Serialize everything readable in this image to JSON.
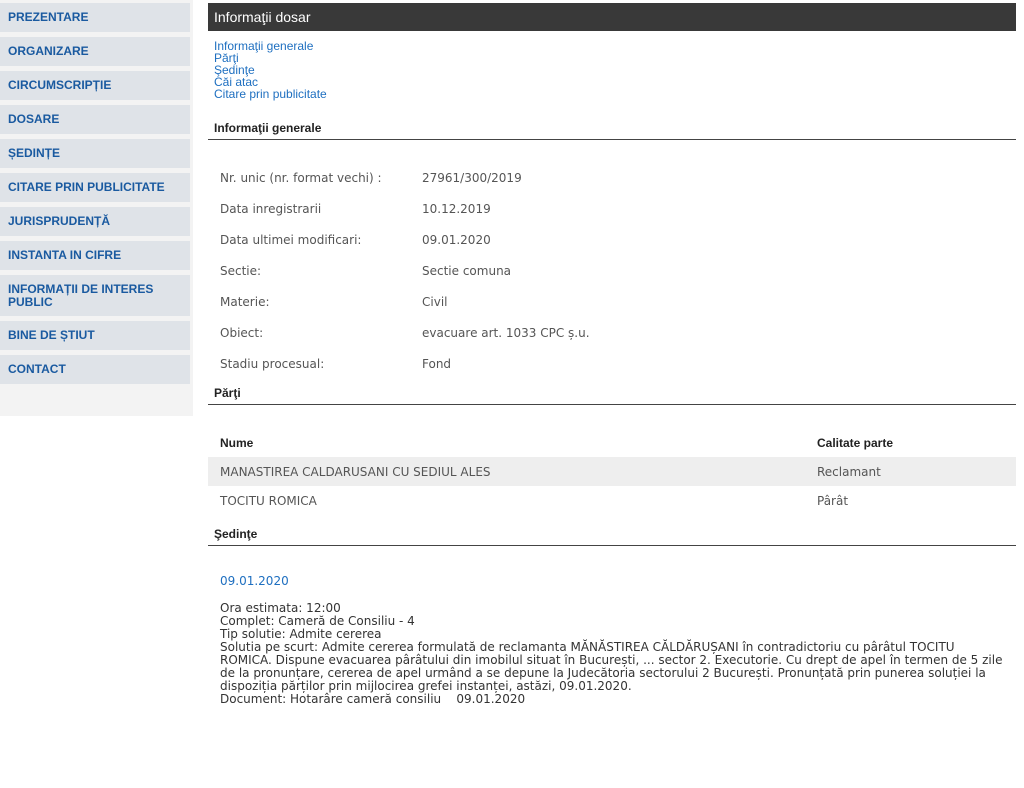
{
  "sidebar": {
    "items": [
      {
        "label": "PREZENTARE"
      },
      {
        "label": "ORGANIZARE"
      },
      {
        "label": "CIRCUMSCRIPȚIE"
      },
      {
        "label": "DOSARE"
      },
      {
        "label": "ȘEDINȚE"
      },
      {
        "label": "CITARE PRIN PUBLICITATE"
      },
      {
        "label": "JURISPRUDENȚĂ"
      },
      {
        "label": "INSTANTA IN CIFRE"
      },
      {
        "label": "INFORMAȚII DE INTERES PUBLIC"
      },
      {
        "label": "BINE DE ȘTIUT"
      },
      {
        "label": "CONTACT"
      }
    ]
  },
  "header": {
    "title": "Informaţii dosar"
  },
  "links": [
    {
      "label": "Informaţii generale"
    },
    {
      "label": "Părţi"
    },
    {
      "label": "Şedinţe"
    },
    {
      "label": "Căi atac"
    },
    {
      "label": "Citare prin publicitate"
    }
  ],
  "general": {
    "section_title": "Informaţii generale",
    "rows": [
      {
        "label": "Nr. unic (nr. format vechi) :",
        "value": "27961/300/2019"
      },
      {
        "label": "Data inregistrarii",
        "value": "10.12.2019"
      },
      {
        "label": "Data ultimei modificari:",
        "value": "09.01.2020"
      },
      {
        "label": "Sectie:",
        "value": "Sectie comuna"
      },
      {
        "label": "Materie:",
        "value": "Civil"
      },
      {
        "label": "Obiect:",
        "value": "evacuare art. 1033 CPC ș.u."
      },
      {
        "label": "Stadiu procesual:",
        "value": "Fond"
      }
    ]
  },
  "parti": {
    "section_title": "Părţi",
    "headers": {
      "name": "Nume",
      "role": "Calitate parte"
    },
    "rows": [
      {
        "name": "MANASTIREA CALDARUSANI CU SEDIUL ALES",
        "role": "Reclamant"
      },
      {
        "name": "TOCITU ROMICA",
        "role": "Pârât"
      }
    ]
  },
  "sedinte": {
    "section_title": "Şedinţe",
    "date": "09.01.2020",
    "ora": "Ora estimata: 12:00",
    "complet": "Complet: Cameră de Consiliu - 4",
    "tip": "Tip solutie: Admite cererea",
    "solutie": "Solutia pe scurt: Admite cererea formulată de reclamanta MĂNĂSTIREA CĂLDĂRUȘANI în contradictoriu cu pârâtul TOCITU ROMICA. Dispune evacuarea pârâtului din imobilul situat în București, ... sector 2. Executorie. Cu drept de apel în termen de 5 zile de la pronunțare, cererea de apel urmând a se depune la Judecătoria sectorului 2 București. Pronunțată prin punerea soluției la dispoziția părților prin mijlocirea grefei instanței, astăzi, 09.01.2020.",
    "document": "Document: Hotarâre cameră consiliu    09.01.2020"
  }
}
